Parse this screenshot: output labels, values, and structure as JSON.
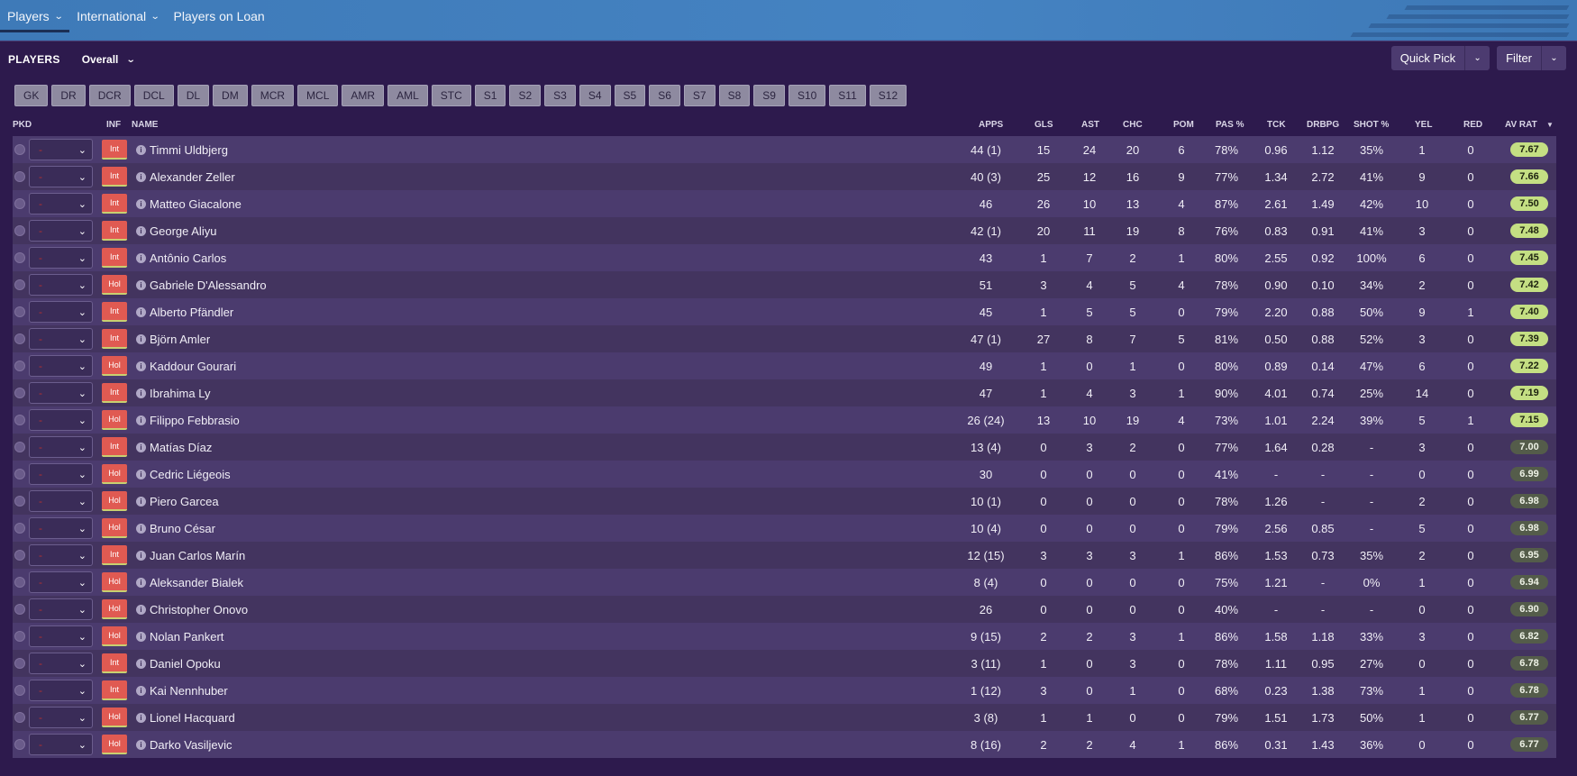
{
  "tabs": [
    {
      "label": "Players",
      "has_dropdown": true,
      "active": true
    },
    {
      "label": "International",
      "has_dropdown": true,
      "active": false
    },
    {
      "label": "Players on Loan",
      "has_dropdown": false,
      "active": false
    }
  ],
  "panel": {
    "title": "PLAYERS",
    "view": "Overall",
    "quick_pick": "Quick Pick",
    "filter": "Filter"
  },
  "positions": [
    "GK",
    "DR",
    "DCR",
    "DCL",
    "DL",
    "DM",
    "MCR",
    "MCL",
    "AMR",
    "AML",
    "STC",
    "S1",
    "S2",
    "S3",
    "S4",
    "S5",
    "S6",
    "S7",
    "S8",
    "S9",
    "S10",
    "S11",
    "S12"
  ],
  "columns": {
    "pkd": "PKD",
    "inf": "INF",
    "name": "NAME",
    "apps": "APPS",
    "gls": "GLS",
    "ast": "AST",
    "chc": "CHC",
    "pom": "POM",
    "pas": "PAS %",
    "tck": "TCK",
    "drbpg": "DRBPG",
    "shot": "SHOT %",
    "yel": "YEL",
    "red": "RED",
    "avrat": "AV RAT"
  },
  "colors": {
    "inf_badge": "#e05a52",
    "rating_high": "#c4df83",
    "rating_mid": "#545c4a"
  },
  "players": [
    {
      "inf": "Int",
      "name": "Timmi Uldbjerg",
      "apps": "44 (1)",
      "gls": "15",
      "ast": "24",
      "chc": "20",
      "pom": "6",
      "pas": "78%",
      "tck": "0.96",
      "drbpg": "1.12",
      "shot": "35%",
      "yel": "1",
      "red": "0",
      "rat": "7.67",
      "tier": "high"
    },
    {
      "inf": "Int",
      "name": "Alexander Zeller",
      "apps": "40 (3)",
      "gls": "25",
      "ast": "12",
      "chc": "16",
      "pom": "9",
      "pas": "77%",
      "tck": "1.34",
      "drbpg": "2.72",
      "shot": "41%",
      "yel": "9",
      "red": "0",
      "rat": "7.66",
      "tier": "high"
    },
    {
      "inf": "Int",
      "name": "Matteo Giacalone",
      "apps": "46",
      "gls": "26",
      "ast": "10",
      "chc": "13",
      "pom": "4",
      "pas": "87%",
      "tck": "2.61",
      "drbpg": "1.49",
      "shot": "42%",
      "yel": "10",
      "red": "0",
      "rat": "7.50",
      "tier": "high"
    },
    {
      "inf": "Int",
      "name": "George Aliyu",
      "apps": "42 (1)",
      "gls": "20",
      "ast": "11",
      "chc": "19",
      "pom": "8",
      "pas": "76%",
      "tck": "0.83",
      "drbpg": "0.91",
      "shot": "41%",
      "yel": "3",
      "red": "0",
      "rat": "7.48",
      "tier": "high"
    },
    {
      "inf": "Int",
      "name": "Antônio Carlos",
      "apps": "43",
      "gls": "1",
      "ast": "7",
      "chc": "2",
      "pom": "1",
      "pas": "80%",
      "tck": "2.55",
      "drbpg": "0.92",
      "shot": "100%",
      "yel": "6",
      "red": "0",
      "rat": "7.45",
      "tier": "high"
    },
    {
      "inf": "Hol",
      "name": "Gabriele D'Alessandro",
      "apps": "51",
      "gls": "3",
      "ast": "4",
      "chc": "5",
      "pom": "4",
      "pas": "78%",
      "tck": "0.90",
      "drbpg": "0.10",
      "shot": "34%",
      "yel": "2",
      "red": "0",
      "rat": "7.42",
      "tier": "high"
    },
    {
      "inf": "Int",
      "name": "Alberto Pfändler",
      "apps": "45",
      "gls": "1",
      "ast": "5",
      "chc": "5",
      "pom": "0",
      "pas": "79%",
      "tck": "2.20",
      "drbpg": "0.88",
      "shot": "50%",
      "yel": "9",
      "red": "1",
      "rat": "7.40",
      "tier": "high"
    },
    {
      "inf": "Int",
      "name": "Björn Amler",
      "apps": "47 (1)",
      "gls": "27",
      "ast": "8",
      "chc": "7",
      "pom": "5",
      "pas": "81%",
      "tck": "0.50",
      "drbpg": "0.88",
      "shot": "52%",
      "yel": "3",
      "red": "0",
      "rat": "7.39",
      "tier": "high"
    },
    {
      "inf": "Hol",
      "name": "Kaddour Gourari",
      "apps": "49",
      "gls": "1",
      "ast": "0",
      "chc": "1",
      "pom": "0",
      "pas": "80%",
      "tck": "0.89",
      "drbpg": "0.14",
      "shot": "47%",
      "yel": "6",
      "red": "0",
      "rat": "7.22",
      "tier": "high"
    },
    {
      "inf": "Int",
      "name": "Ibrahima Ly",
      "apps": "47",
      "gls": "1",
      "ast": "4",
      "chc": "3",
      "pom": "1",
      "pas": "90%",
      "tck": "4.01",
      "drbpg": "0.74",
      "shot": "25%",
      "yel": "14",
      "red": "0",
      "rat": "7.19",
      "tier": "high"
    },
    {
      "inf": "Hol",
      "name": "Filippo Febbrasio",
      "apps": "26 (24)",
      "gls": "13",
      "ast": "10",
      "chc": "19",
      "pom": "4",
      "pas": "73%",
      "tck": "1.01",
      "drbpg": "2.24",
      "shot": "39%",
      "yel": "5",
      "red": "1",
      "rat": "7.15",
      "tier": "high"
    },
    {
      "inf": "Int",
      "name": "Matías Díaz",
      "apps": "13 (4)",
      "gls": "0",
      "ast": "3",
      "chc": "2",
      "pom": "0",
      "pas": "77%",
      "tck": "1.64",
      "drbpg": "0.28",
      "shot": "-",
      "yel": "3",
      "red": "0",
      "rat": "7.00",
      "tier": "mid"
    },
    {
      "inf": "Hol",
      "name": "Cedric Liégeois",
      "apps": "30",
      "gls": "0",
      "ast": "0",
      "chc": "0",
      "pom": "0",
      "pas": "41%",
      "tck": "-",
      "drbpg": "-",
      "shot": "-",
      "yel": "0",
      "red": "0",
      "rat": "6.99",
      "tier": "mid"
    },
    {
      "inf": "Hol",
      "name": "Piero Garcea",
      "apps": "10 (1)",
      "gls": "0",
      "ast": "0",
      "chc": "0",
      "pom": "0",
      "pas": "78%",
      "tck": "1.26",
      "drbpg": "-",
      "shot": "-",
      "yel": "2",
      "red": "0",
      "rat": "6.98",
      "tier": "mid"
    },
    {
      "inf": "Hol",
      "name": "Bruno César",
      "apps": "10 (4)",
      "gls": "0",
      "ast": "0",
      "chc": "0",
      "pom": "0",
      "pas": "79%",
      "tck": "2.56",
      "drbpg": "0.85",
      "shot": "-",
      "yel": "5",
      "red": "0",
      "rat": "6.98",
      "tier": "mid"
    },
    {
      "inf": "Int",
      "name": "Juan Carlos Marín",
      "apps": "12 (15)",
      "gls": "3",
      "ast": "3",
      "chc": "3",
      "pom": "1",
      "pas": "86%",
      "tck": "1.53",
      "drbpg": "0.73",
      "shot": "35%",
      "yel": "2",
      "red": "0",
      "rat": "6.95",
      "tier": "mid"
    },
    {
      "inf": "Hol",
      "name": "Aleksander Bialek",
      "apps": "8 (4)",
      "gls": "0",
      "ast": "0",
      "chc": "0",
      "pom": "0",
      "pas": "75%",
      "tck": "1.21",
      "drbpg": "-",
      "shot": "0%",
      "yel": "1",
      "red": "0",
      "rat": "6.94",
      "tier": "mid"
    },
    {
      "inf": "Hol",
      "name": "Christopher Onovo",
      "apps": "26",
      "gls": "0",
      "ast": "0",
      "chc": "0",
      "pom": "0",
      "pas": "40%",
      "tck": "-",
      "drbpg": "-",
      "shot": "-",
      "yel": "0",
      "red": "0",
      "rat": "6.90",
      "tier": "mid"
    },
    {
      "inf": "Hol",
      "name": "Nolan Pankert",
      "apps": "9 (15)",
      "gls": "2",
      "ast": "2",
      "chc": "3",
      "pom": "1",
      "pas": "86%",
      "tck": "1.58",
      "drbpg": "1.18",
      "shot": "33%",
      "yel": "3",
      "red": "0",
      "rat": "6.82",
      "tier": "mid"
    },
    {
      "inf": "Int",
      "name": "Daniel Opoku",
      "apps": "3 (11)",
      "gls": "1",
      "ast": "0",
      "chc": "3",
      "pom": "0",
      "pas": "78%",
      "tck": "1.11",
      "drbpg": "0.95",
      "shot": "27%",
      "yel": "0",
      "red": "0",
      "rat": "6.78",
      "tier": "mid"
    },
    {
      "inf": "Int",
      "name": "Kai Nennhuber",
      "apps": "1 (12)",
      "gls": "3",
      "ast": "0",
      "chc": "1",
      "pom": "0",
      "pas": "68%",
      "tck": "0.23",
      "drbpg": "1.38",
      "shot": "73%",
      "yel": "1",
      "red": "0",
      "rat": "6.78",
      "tier": "mid"
    },
    {
      "inf": "Hol",
      "name": "Lionel Hacquard",
      "apps": "3 (8)",
      "gls": "1",
      "ast": "1",
      "chc": "0",
      "pom": "0",
      "pas": "79%",
      "tck": "1.51",
      "drbpg": "1.73",
      "shot": "50%",
      "yel": "1",
      "red": "0",
      "rat": "6.77",
      "tier": "mid"
    },
    {
      "inf": "Hol",
      "name": "Darko Vasiljevic",
      "apps": "8 (16)",
      "gls": "2",
      "ast": "2",
      "chc": "4",
      "pom": "1",
      "pas": "86%",
      "tck": "0.31",
      "drbpg": "1.43",
      "shot": "36%",
      "yel": "0",
      "red": "0",
      "rat": "6.77",
      "tier": "mid"
    }
  ]
}
